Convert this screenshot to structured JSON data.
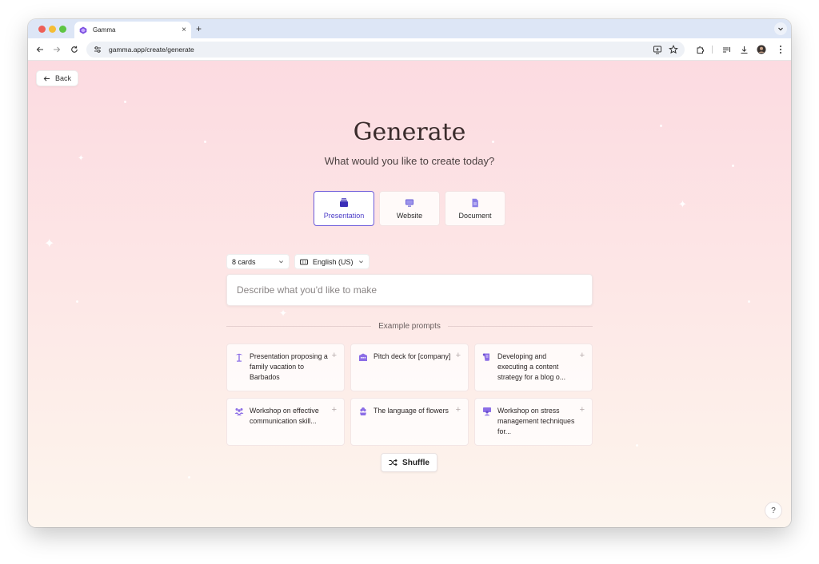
{
  "browser": {
    "tab_title": "Gamma",
    "new_tab": "+",
    "tab_close": "×",
    "url": "gamma.app/create/generate"
  },
  "page": {
    "back_label": "Back",
    "title": "Generate",
    "subtitle": "What would you like to create today?",
    "types": [
      {
        "label": "Presentation",
        "icon": "presentation-icon",
        "selected": true
      },
      {
        "label": "Website",
        "icon": "monitor-icon",
        "selected": false
      },
      {
        "label": "Document",
        "icon": "document-icon",
        "selected": false
      }
    ],
    "card_count": "8 cards",
    "language": "English (US)",
    "prompt_placeholder": "Describe what you'd like to make",
    "examples_label": "Example prompts",
    "examples": [
      {
        "text": "Presentation proposing a family vacation to Barbados",
        "icon": "palm-tree-icon"
      },
      {
        "text": "Pitch deck for [company]",
        "icon": "building-icon"
      },
      {
        "text": "Developing and executing a content strategy for a blog o...",
        "icon": "scroll-icon"
      },
      {
        "text": "Workshop on effective communication skill...",
        "icon": "people-icon"
      },
      {
        "text": "The language of flowers",
        "icon": "flower-icon"
      },
      {
        "text": "Workshop on stress management techniques for...",
        "icon": "teacher-icon"
      }
    ],
    "shuffle_label": "Shuffle",
    "help_label": "?"
  },
  "colors": {
    "accent": "#6c5bd9",
    "icon_purple": "#8c6ee6"
  }
}
